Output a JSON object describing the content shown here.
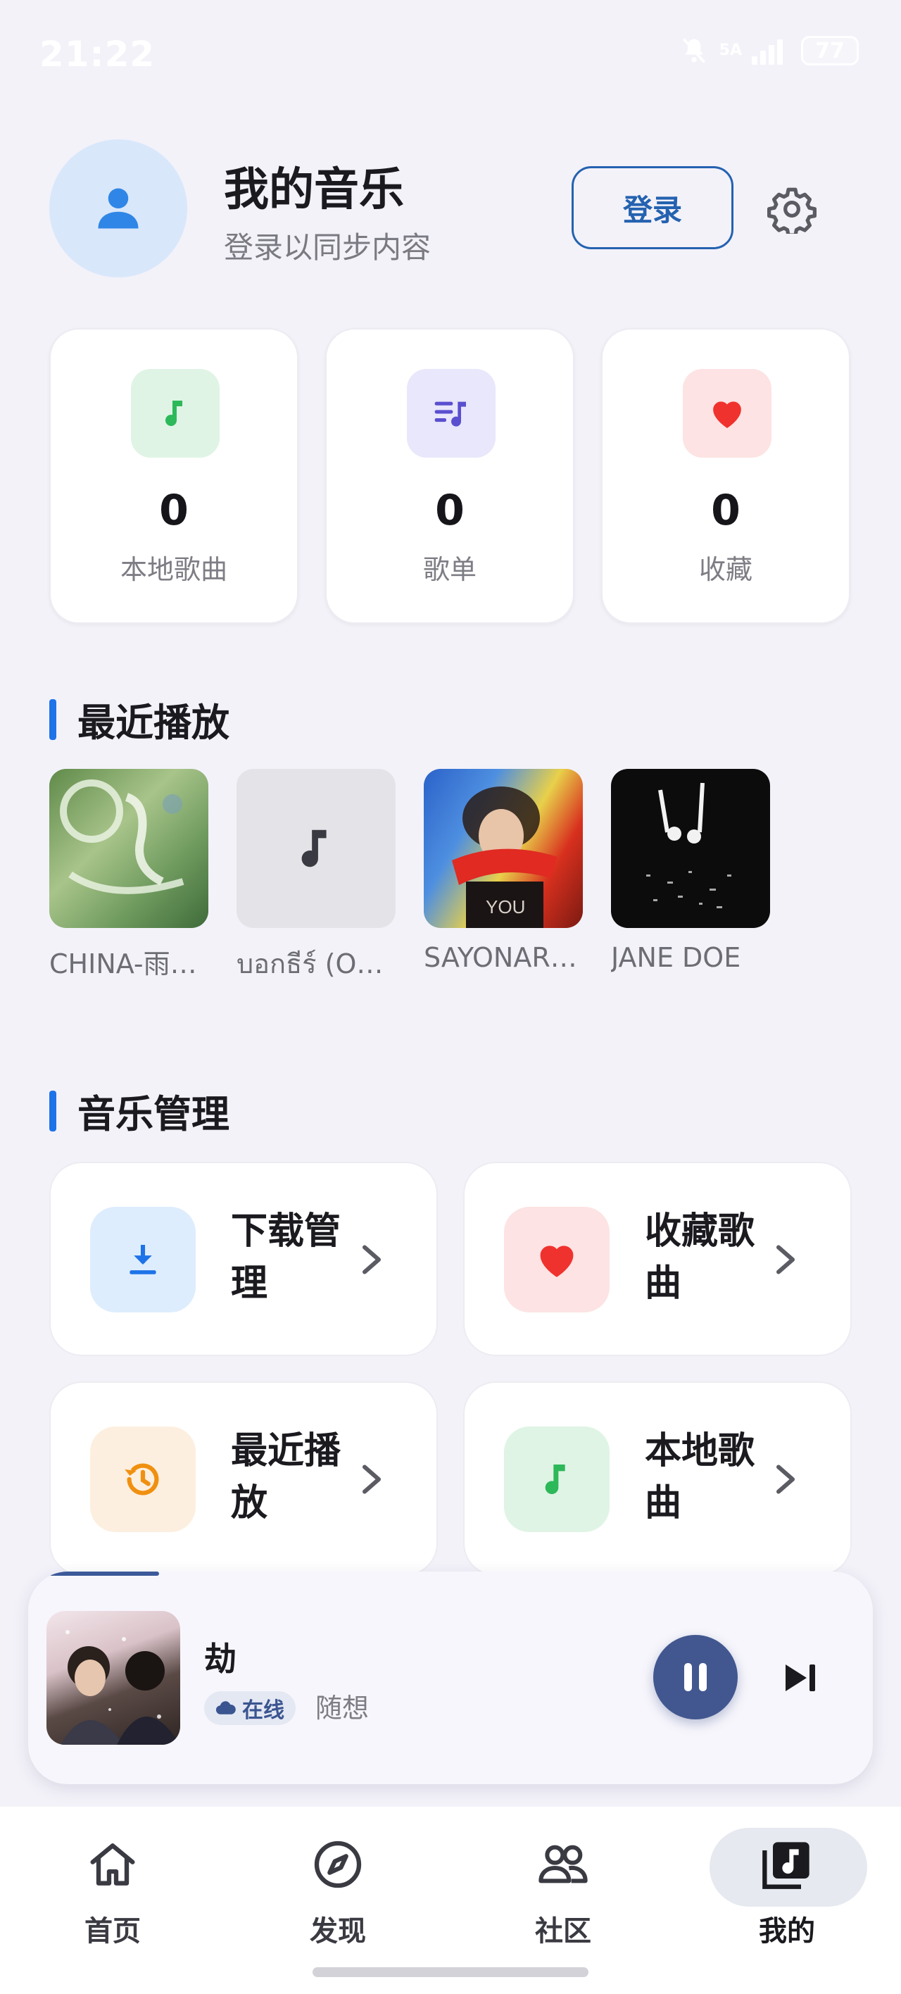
{
  "status_bar": {
    "time": "21:22",
    "network": "5A",
    "battery": "77"
  },
  "header": {
    "title": "我的音乐",
    "subtitle": "登录以同步内容",
    "login_label": "登录"
  },
  "stats": [
    {
      "value": "0",
      "label": "本地歌曲",
      "icon": "music-note-icon",
      "color": "#2db85a"
    },
    {
      "value": "0",
      "label": "歌单",
      "icon": "playlist-icon",
      "color": "#5a4fcf"
    },
    {
      "value": "0",
      "label": "收藏",
      "icon": "heart-icon",
      "color": "#f0322e"
    }
  ],
  "recent": {
    "title": "最近播放",
    "items": [
      {
        "name": "CHINA-雨…"
      },
      {
        "name": "บอกธีร์ (O…"
      },
      {
        "name": "SAYONAR…"
      },
      {
        "name": "JANE DOE"
      }
    ]
  },
  "manage": {
    "title": "音乐管理",
    "items": [
      {
        "label": "下载管理",
        "icon": "download-icon",
        "color": "#1e73e8"
      },
      {
        "label": "收藏歌曲",
        "icon": "heart-icon",
        "color": "#f0322e"
      },
      {
        "label": "最近播放",
        "icon": "history-icon",
        "color": "#f09010"
      },
      {
        "label": "本地歌曲",
        "icon": "music-note-icon",
        "color": "#2db85a"
      }
    ]
  },
  "player": {
    "title": "劫",
    "badge": "在线",
    "artist": "随想",
    "progress": 0.13
  },
  "nav": [
    {
      "label": "首页",
      "icon": "home-icon"
    },
    {
      "label": "发现",
      "icon": "compass-icon"
    },
    {
      "label": "社区",
      "icon": "community-icon"
    },
    {
      "label": "我的",
      "icon": "my-music-icon",
      "active": true
    }
  ]
}
